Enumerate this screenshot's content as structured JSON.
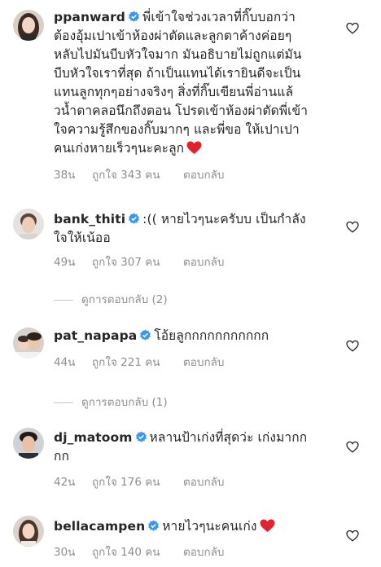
{
  "comments": [
    {
      "username": "ppanward",
      "lines": [
        "พี่เข้าใจช่วงเวลาที่กิ๊บบอกว่า",
        "ต้องอุ้มเปาเข้าห้องผ่าตัดและลูกตาค้างค่อยๆ",
        "หลับไปมันบีบหัวใจมาก มันอธิบายไม่ถูกแต่มัน",
        "บีบหัวใจเราที่สุด ถ้าเป็นแทนได้เรายินดีจะเป็น",
        "แทนลูกทุกๆอย่างจริงๆ สิ่งที่กิ๊บเขียนพี่อ่านแล้",
        "วน้ำตาคลอนึกถึงตอน โปรดเข้าห้องผ่าตัดพี่เข้า",
        "ใจความรู้สึกของกิ๊บมากๆ และพี่ขอ ให้เปาเปา",
        "คนเก่งหายเร็วๆนะคะลูก"
      ],
      "time": "38น",
      "likes": "ถูกใจ 343 คน",
      "reply": "ตอบกลับ"
    },
    {
      "username": "bank_thiti",
      "lines": [
        ":(( หายไวๆนะครับบ เป็นกำลัง",
        "ใจให้เน้ออ"
      ],
      "time": "49น",
      "likes": "ถูกใจ 307 คน",
      "reply": "ตอบกลับ",
      "replies": "ดูการตอบกลับ (2)"
    },
    {
      "username": "pat_napapa",
      "lines": [
        "โอ้ยลูกกกกกกกกกกก"
      ],
      "time": "44น",
      "likes": "ถูกใจ 221 คน",
      "reply": "ตอบกลับ",
      "replies": "ดูการตอบกลับ (1)"
    },
    {
      "username": "dj_matoom",
      "lines": [
        "หลานป้าเก่งที่สุดว่ะ เก่งมากก",
        "กก"
      ],
      "time": "42น",
      "likes": "ถูกใจ 176 คน",
      "reply": "ตอบกลับ"
    },
    {
      "username": "bellacampen",
      "lines": [
        "หายไวๆนะคนเก่ง"
      ],
      "time": "30น",
      "likes": "ถูกใจ 140 คน",
      "reply": "ตอบกลับ"
    }
  ],
  "colors": {
    "text": "#262626",
    "meta": "#8e8e8e",
    "verified": "#3897f0",
    "heart_emoji": "#e0242f",
    "like_outline": "#262626"
  },
  "icons": {
    "verified": "verified-badge-icon",
    "like": "heart-outline-icon",
    "emoji": "red-heart-emoji"
  }
}
